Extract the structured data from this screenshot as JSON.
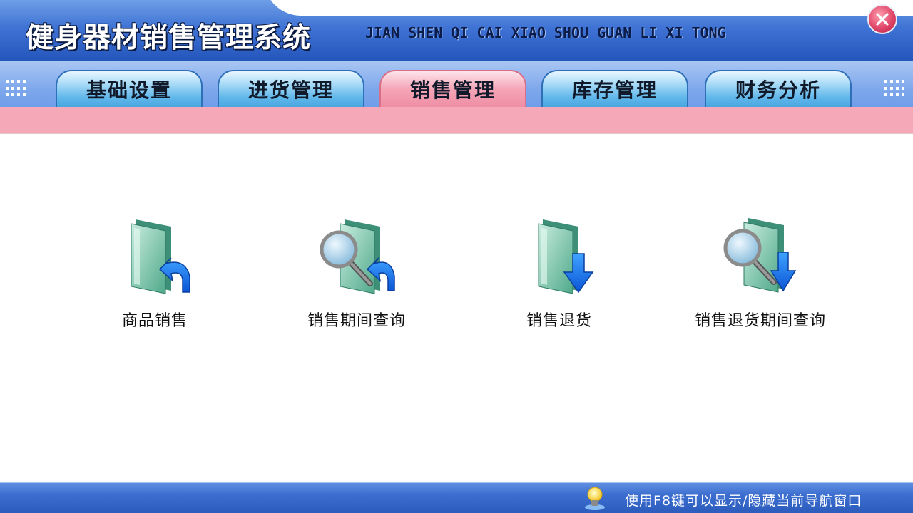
{
  "app": {
    "title": "健身器材销售管理系统",
    "subtitle": "JIAN SHEN QI CAI XIAO SHOU GUAN LI XI TONG"
  },
  "tabs": [
    {
      "label": "基础设置",
      "active": false
    },
    {
      "label": "进货管理",
      "active": false
    },
    {
      "label": "销售管理",
      "active": true
    },
    {
      "label": "库存管理",
      "active": false
    },
    {
      "label": "财务分析",
      "active": false
    }
  ],
  "items": [
    {
      "label": "商品销售",
      "icon": "folder-arrow-icon"
    },
    {
      "label": "销售期间查询",
      "icon": "folder-search-arrow-icon"
    },
    {
      "label": "销售退货",
      "icon": "folder-down-arrow-icon"
    },
    {
      "label": "销售退货期间查询",
      "icon": "folder-search-down-arrow-icon"
    }
  ],
  "status": {
    "hint": "使用F8键可以显示/隐藏当前导航窗口",
    "icon": "lightbulb-icon"
  },
  "colors": {
    "header": "#3f73d4",
    "tabbar": "#7fa8ec",
    "active_tab": "#f5a5b7",
    "pink_strip": "#f5a8b8",
    "statusbar": "#3c6ed0"
  }
}
